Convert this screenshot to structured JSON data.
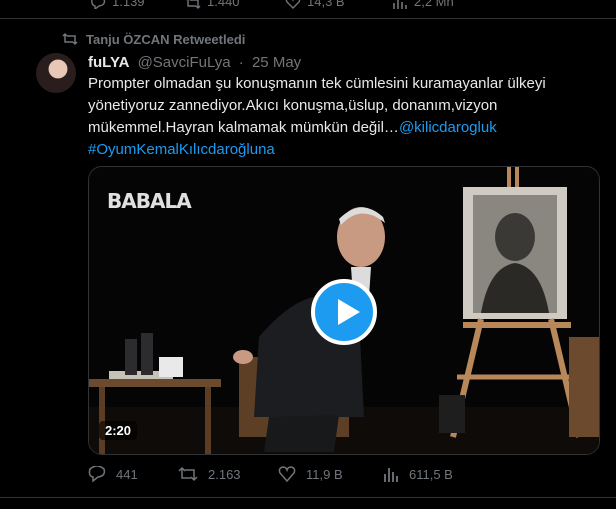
{
  "prev_tweet": {
    "replies": "1.139",
    "retweets": "1.440",
    "likes": "14,3 B",
    "views": "2,2 Mn"
  },
  "retweet_banner": "Tanju ÖZCAN Retweetledi",
  "tweet": {
    "display_name": "fuLYA",
    "handle": "@SavciFuLya",
    "separator": "·",
    "date": "25 May",
    "text_line1": "Prompter olmadan şu konuşmanın tek cümlesini kuramayanlar ülkeyi",
    "text_line2": "yönetiyoruz zannediyor.Akıcı konuşma,üslup, donanım,vizyon",
    "text_line3_plain": "mükemmel.Hayran kalmamak mümkün değil…",
    "mention": "@kilicdarogluk",
    "hashtag": "#OyumKemalKılıcdaroğluna",
    "video": {
      "brand": "BABALA",
      "duration": "2:20"
    },
    "stats": {
      "replies": "441",
      "retweets": "2.163",
      "likes": "11,9 B",
      "views": "611,5 B"
    }
  },
  "colors": {
    "background": "#000000",
    "text": "#e7e9ea",
    "muted": "#71767b",
    "link": "#1d9bf0",
    "divider": "#2f3336"
  }
}
